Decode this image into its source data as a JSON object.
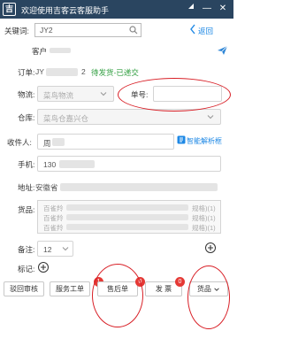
{
  "window": {
    "logo": "吉",
    "title": "欢迎使用吉客云客服助手",
    "pin": "⊿",
    "minimize": "—",
    "close": "✕"
  },
  "search": {
    "label": "关键词:",
    "value": "JY2",
    "back_label": "返回"
  },
  "customer": {
    "label": "客户"
  },
  "order": {
    "label": "订单:",
    "number_prefix": "JY",
    "number_suffix": "2",
    "status": "待发货-已递交"
  },
  "logistics": {
    "label": "物流:",
    "value": "菜鸟物流",
    "tracking_label": "单号:"
  },
  "warehouse": {
    "label": "仓库:",
    "value": "菜鸟仓嘉兴仓"
  },
  "receiver": {
    "label": "收件人:",
    "value": "周",
    "smart_parse": "智能解析框"
  },
  "phone": {
    "label": "手机:",
    "value": "130"
  },
  "address": {
    "label": "地址:",
    "value": "安徽省"
  },
  "goods": {
    "label": "货品:",
    "lines": [
      "百雀羚",
      "百雀羚",
      "百雀羚"
    ],
    "specs": [
      "规格)(1)",
      "规格)(1)",
      "规格)(1)"
    ]
  },
  "remark": {
    "label": "备注:",
    "value": "12"
  },
  "tag": {
    "label": "标记:"
  },
  "buttons": {
    "review": "驳回审核",
    "service_ticket": "服务工单",
    "service_badge": "1",
    "after_sale": "售后单",
    "after_sale_badge": "0",
    "invoice": "发 票",
    "invoice_badge": "0",
    "goods": "货品"
  },
  "colors": {
    "titlebar": "#2a4560",
    "accent_blue": "#1e88e5",
    "status_green": "#2e9d3e",
    "annotation_red": "#d81f26",
    "badge_red": "#e53935"
  }
}
